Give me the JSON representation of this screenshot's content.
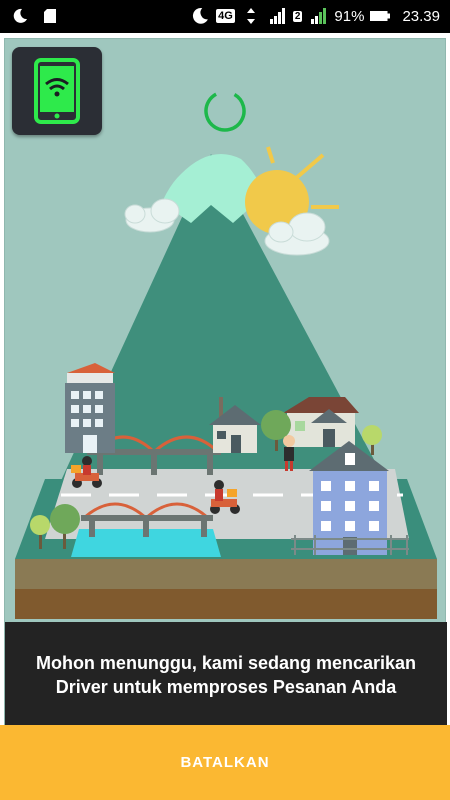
{
  "status_bar": {
    "network_type": "4G",
    "sim_slot": "2",
    "battery_percent": "91%",
    "time": "23.39",
    "icons": [
      "moon-icon",
      "sd-card-icon",
      "moon-icon",
      "data-arrows-icon",
      "signal-icon",
      "battery-icon"
    ]
  },
  "app": {
    "app_icon": "phone-wifi-icon",
    "loading_indicator": "spinner",
    "message": "Mohon menunggu, kami sedang mencarikan Driver untuk memproses Pesanan Anda",
    "cancel_label": "BATALKAN"
  },
  "colors": {
    "scene_background": "#9fc7be",
    "mountain": "#3f8f7c",
    "snow_cap": "#a5efd4",
    "sun": "#f1c94a",
    "message_background": "#232323",
    "cancel_background": "#fbb832",
    "spinner": "#1db84a",
    "app_icon_green": "#2eea4b"
  }
}
